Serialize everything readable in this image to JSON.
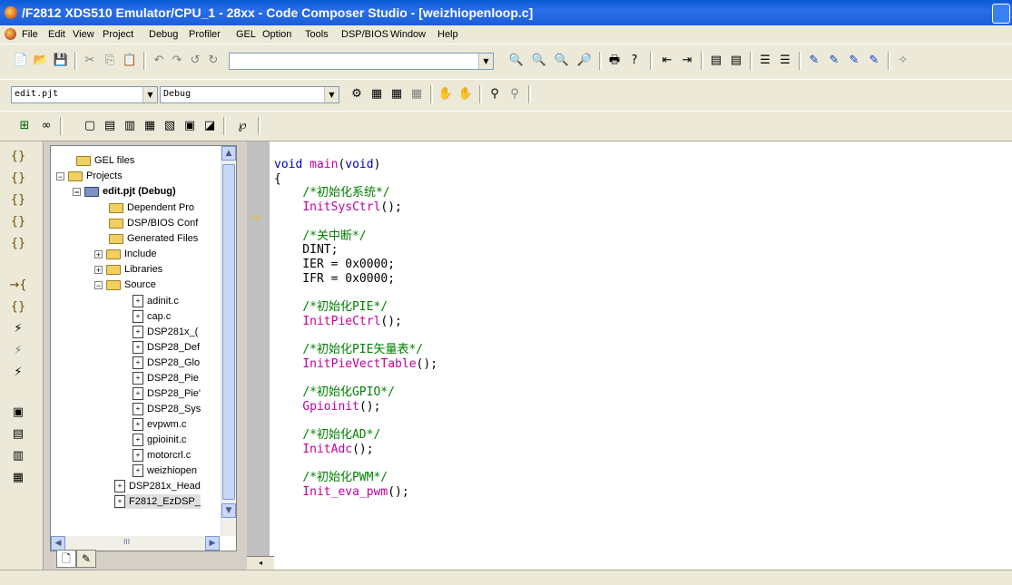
{
  "window": {
    "title": "/F2812 XDS510 Emulator/CPU_1 - 28xx - Code Composer Studio - [weizhiopenloop.c]"
  },
  "menu": [
    "File",
    "Edit",
    "View",
    "Project",
    "Debug",
    "Profiler",
    "GEL",
    "Option",
    "Tools",
    "DSP/BIOS",
    "Window",
    "Help"
  ],
  "toolbar": {
    "project_select": "edit.pjt",
    "config_select": "Debug",
    "find_combo": ""
  },
  "tree": {
    "items": [
      {
        "label": "GEL files",
        "kind": "folder"
      },
      {
        "label": "Projects",
        "kind": "folder",
        "toggle": "−"
      },
      {
        "label": "edit.pjt (Debug)",
        "kind": "project",
        "toggle": "−"
      },
      {
        "label": "Dependent Pro",
        "kind": "folder"
      },
      {
        "label": "DSP/BIOS Conf",
        "kind": "folder"
      },
      {
        "label": "Generated Files",
        "kind": "folder"
      },
      {
        "label": "Include",
        "kind": "folder",
        "toggle": "+"
      },
      {
        "label": "Libraries",
        "kind": "folder",
        "toggle": "+"
      },
      {
        "label": "Source",
        "kind": "folder",
        "toggle": "−"
      },
      {
        "label": "adinit.c",
        "kind": "file"
      },
      {
        "label": "cap.c",
        "kind": "file"
      },
      {
        "label": "DSP281x_(",
        "kind": "file"
      },
      {
        "label": "DSP28_Def",
        "kind": "file"
      },
      {
        "label": "DSP28_Glo",
        "kind": "file"
      },
      {
        "label": "DSP28_Pie",
        "kind": "file"
      },
      {
        "label": "DSP28_Pie'",
        "kind": "file"
      },
      {
        "label": "DSP28_Sys",
        "kind": "file"
      },
      {
        "label": "evpwm.c",
        "kind": "file"
      },
      {
        "label": "gpioinit.c",
        "kind": "file"
      },
      {
        "label": "motorcrl.c",
        "kind": "file"
      },
      {
        "label": "weizhiopen",
        "kind": "file"
      },
      {
        "label": "DSP281x_Head",
        "kind": "file"
      },
      {
        "label": "F2812_EzDSP_",
        "kind": "file"
      }
    ],
    "scroll_h_label": "III"
  },
  "code": [
    {
      "t": "kw",
      "s": "void"
    },
    {
      "t": "",
      "s": " "
    },
    {
      "t": "fn",
      "s": "main"
    },
    {
      "t": "",
      "s": "("
    },
    {
      "t": "kw",
      "s": "void"
    },
    {
      "t": "",
      "s": ")\n{\n    "
    },
    {
      "t": "cm",
      "s": "/*初始化系统*/"
    },
    {
      "t": "",
      "s": "\n    "
    },
    {
      "t": "fn",
      "s": "InitSysCtrl"
    },
    {
      "t": "",
      "s": "();\n\n    "
    },
    {
      "t": "cm",
      "s": "/*关中断*/"
    },
    {
      "t": "",
      "s": "\n    DINT;\n    IER = 0x0000;\n    IFR = 0x0000;\n\n    "
    },
    {
      "t": "cm",
      "s": "/*初始化PIE*/"
    },
    {
      "t": "",
      "s": "\n    "
    },
    {
      "t": "fn",
      "s": "InitPieCtrl"
    },
    {
      "t": "",
      "s": "();\n\n    "
    },
    {
      "t": "cm",
      "s": "/*初始化PIE矢量表*/"
    },
    {
      "t": "",
      "s": "\n    "
    },
    {
      "t": "fn",
      "s": "InitPieVectTable"
    },
    {
      "t": "",
      "s": "();\n\n    "
    },
    {
      "t": "cm",
      "s": "/*初始化GPIO*/"
    },
    {
      "t": "",
      "s": "\n    "
    },
    {
      "t": "fn",
      "s": "Gpioinit"
    },
    {
      "t": "",
      "s": "();\n\n    "
    },
    {
      "t": "cm",
      "s": "/*初始化AD*/"
    },
    {
      "t": "",
      "s": "\n    "
    },
    {
      "t": "fn",
      "s": "InitAdc"
    },
    {
      "t": "",
      "s": "();\n\n    "
    },
    {
      "t": "cm",
      "s": "/*初始化PWM*/"
    },
    {
      "t": "",
      "s": "\n    "
    },
    {
      "t": "fn",
      "s": "Init_eva_pwm"
    },
    {
      "t": "",
      "s": "();"
    }
  ],
  "colors": {
    "keyword": "#0000c0",
    "function": "#c000a0",
    "comment": "#008000",
    "titlebar": "#0a5ad6"
  }
}
